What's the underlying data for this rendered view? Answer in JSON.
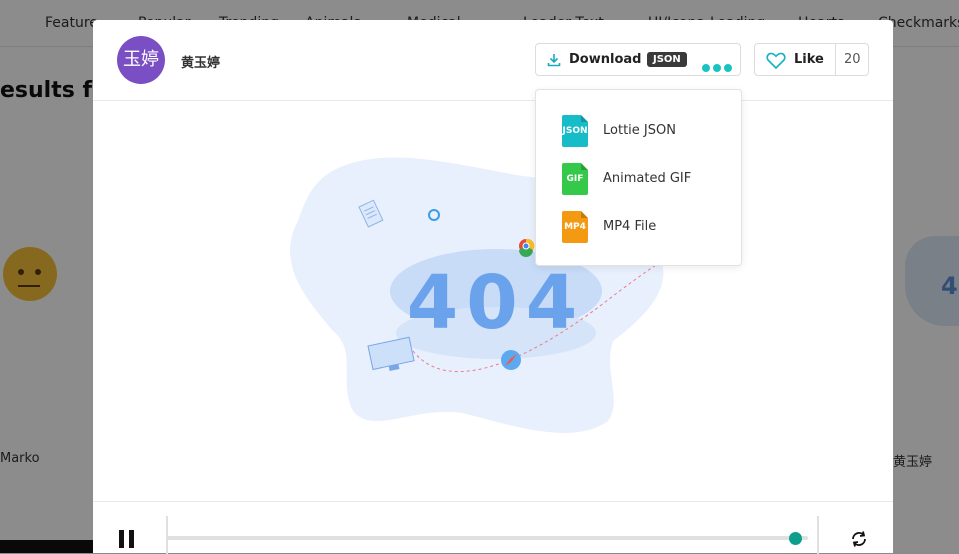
{
  "background": {
    "nav_items": [
      "Feature",
      "Popular",
      "Trending",
      "Animals",
      "Medical",
      "Loader Text",
      "UI/Icons",
      "Loading",
      "Hearts",
      "Checkmarks"
    ],
    "results_heading": "esults fo",
    "left_author": "Marko",
    "right_author": "黄玉婷",
    "right_art_text": "4"
  },
  "modal": {
    "avatar_text": "玉婷",
    "author_name": "黄玉婷",
    "download": {
      "label": "Download",
      "format_badge": "JSON",
      "more_icon": "three-dots-icon"
    },
    "like": {
      "label": "Like",
      "count": "20"
    },
    "dropdown_items": [
      {
        "icon_text": "JSON",
        "label": "Lottie JSON",
        "color": "#17bcc9"
      },
      {
        "icon_text": "GIF",
        "label": "Animated GIF",
        "color": "#35c94a"
      },
      {
        "icon_text": "MP4",
        "label": "MP4 File",
        "color": "#f39a12"
      }
    ],
    "animation": {
      "main_text": "404"
    },
    "player": {
      "progress": 0.98,
      "pause_icon": "pause-icon",
      "loop_icon": "loop-icon"
    }
  },
  "colors": {
    "accent": "#19c3c3",
    "progress_knob": "#0e9f8c",
    "avatar": "#7b4fc4"
  }
}
